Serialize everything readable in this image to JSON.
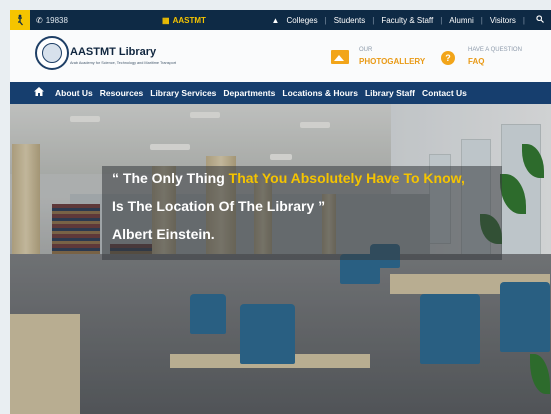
{
  "topbar": {
    "phone": "19838",
    "brand": "AASTMT",
    "links": [
      "Colleges",
      "Students",
      "Faculty & Staff",
      "Alumni",
      "Visitors"
    ]
  },
  "header": {
    "title": "AASTMT Library",
    "subtitle": "Arab Academy for Science, Technology and Maritime Transport",
    "gallery_small": "OUR",
    "gallery_big": "PHOTOGALLERY",
    "faq_small": "HAVE A QUESTION",
    "faq_big": "FAQ"
  },
  "nav": {
    "items": [
      "About Us",
      "Resources",
      "Library Services",
      "Departments",
      "Locations & Hours",
      "Library Staff",
      "Contact Us"
    ]
  },
  "hero": {
    "quote_open": "“",
    "quote_part1": "The Only Thing ",
    "quote_part2": "That You Absolutely Have To Know,",
    "quote_line2": "Is The Location Of The Library ”",
    "author": "Albert Einstein."
  },
  "icons": {
    "accessibility": "accessibility-icon",
    "phone": "phone-icon",
    "graduation": "graduation-cap-icon",
    "search": "search-icon",
    "home": "home-icon",
    "gallery": "image-gallery-icon",
    "faq": "question-icon"
  },
  "colors": {
    "navy": "#0e2a45",
    "nav_blue": "#163e6e",
    "accent_orange": "#e99a16",
    "accent_yellow": "#f5c400"
  }
}
